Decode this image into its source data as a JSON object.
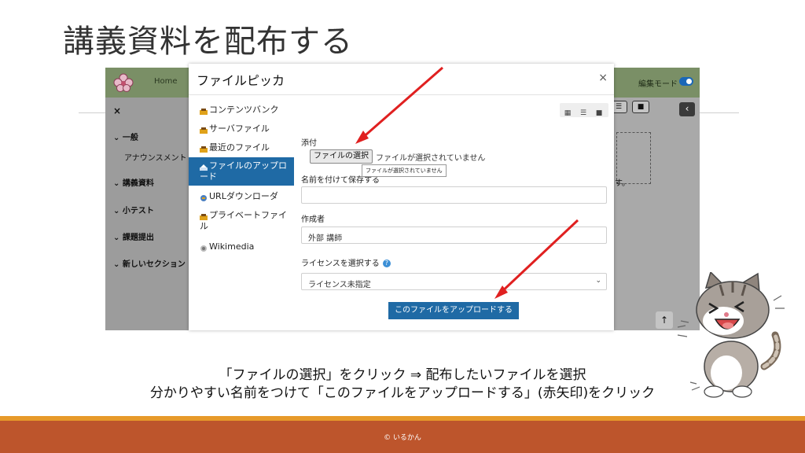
{
  "slide": {
    "title": "講義資料を配布する",
    "caption_line1": "「ファイルの選択」をクリック ⇒ 配布したいファイルを選択",
    "caption_line2": "分かりやすい名前をつけて「このファイルをアップロードする」(赤矢印)をクリック",
    "copyright": "© いるかん"
  },
  "moodle": {
    "home": "Home",
    "edit_mode": "編集モード",
    "drawer": {
      "close": "×",
      "general": "一般",
      "announcements": "アナウンスメント",
      "lecture_materials": "講義資料",
      "quiz": "小テスト",
      "assignment": "課題提出",
      "new_section": "新しいセクション"
    },
    "partial_text": "す。"
  },
  "filepicker": {
    "title": "ファイルピッカ",
    "close": "×",
    "repositories": [
      {
        "label": "コンテンツバンク",
        "icon": "repository-icon"
      },
      {
        "label": "サーバファイル",
        "icon": "repository-icon"
      },
      {
        "label": "最近のファイル",
        "icon": "repository-icon"
      },
      {
        "label": "ファイルのアップロード",
        "icon": "upload-icon",
        "active": true
      },
      {
        "label": "URLダウンローダ",
        "icon": "url-icon"
      },
      {
        "label": "プライベートファイル",
        "icon": "repository-icon"
      },
      {
        "label": "Wikimedia",
        "icon": "wikimedia-icon"
      }
    ],
    "attachment_label": "添付",
    "choose_file_button": "ファイルの選択",
    "no_file_selected": "ファイルが選択されていません",
    "tooltip": "ファイルが選択されていません",
    "save_as_label": "名前を付けて保存する",
    "save_as_value": "",
    "author_label": "作成者",
    "author_value": "外部 講師",
    "license_label": "ライセンスを選択する",
    "license_value": "ライセンス未指定",
    "upload_button": "このファイルをアップロードする"
  },
  "colors": {
    "header_green": "#7a8f66",
    "primary_blue": "#1f6aa5",
    "arrow_red": "#e02020",
    "footer_orange": "#bd552c",
    "footer_stripe": "#e79a2a"
  }
}
